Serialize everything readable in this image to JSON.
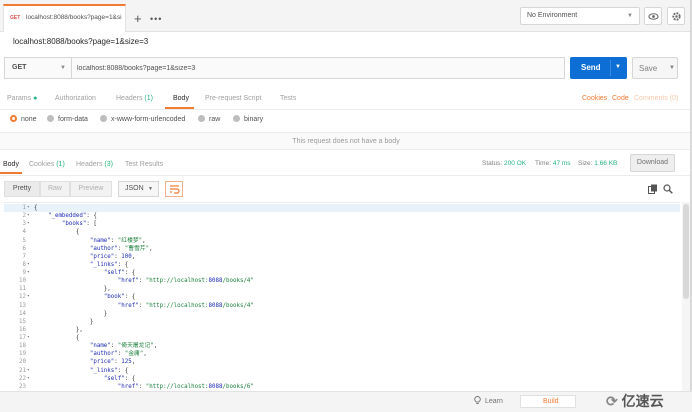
{
  "tab": {
    "method": "GET",
    "title": "localhost:8088/books?page=1&si"
  },
  "environment": {
    "selected": "No Environment"
  },
  "request": {
    "title": "localhost:8088/books?page=1&size=3",
    "method": "GET",
    "url": "localhost:8088/books?page=1&size=3",
    "send_label": "Send",
    "save_label": "Save"
  },
  "request_tabs": {
    "params": "Params",
    "authorization": "Authorization",
    "headers": "Headers",
    "headers_count": "(1)",
    "body": "Body",
    "prerequest": "Pre-request Script",
    "tests": "Tests",
    "cookies": "Cookies",
    "code": "Code",
    "comments": "Comments (0)"
  },
  "body_types": [
    "none",
    "form-data",
    "x-www-form-urlencoded",
    "raw",
    "binary"
  ],
  "no_body_message": "This request does not have a body",
  "response_tabs": {
    "body": "Body",
    "cookies": "Cookies",
    "cookies_count": "(1)",
    "headers": "Headers",
    "headers_count": "(3)",
    "test_results": "Test Results"
  },
  "response_status": {
    "status_label": "Status:",
    "status_value": "200 OK",
    "time_label": "Time:",
    "time_value": "47 ms",
    "size_label": "Size:",
    "size_value": "1.66 KB",
    "download_label": "Download"
  },
  "view_modes": [
    "Pretty",
    "Raw",
    "Preview"
  ],
  "format": "JSON",
  "code_lines": [
    "{",
    "    \"_embedded\": {",
    "        \"books\": [",
    "            {",
    "                \"name\": \"红楼梦\",",
    "                \"author\": \"曹雪芹\",",
    "                \"price\": 100,",
    "                \"_links\": {",
    "                    \"self\": {",
    "                        \"href\": \"http://localhost:8088/books/4\"",
    "                    },",
    "                    \"book\": {",
    "                        \"href\": \"http://localhost:8088/books/4\"",
    "                    }",
    "                }",
    "            },",
    "            {",
    "                \"name\": \"倚天屠龙记\",",
    "                \"author\": \"金庸\",",
    "                \"price\": 125,",
    "                \"_links\": {",
    "                    \"self\": {",
    "                        \"href\": \"http://localhost:8088/books/6\""
  ],
  "folded_lines": [
    1,
    2,
    3,
    8,
    9,
    12,
    17,
    21,
    22
  ],
  "status_bar": {
    "learn": "Learn",
    "build": "Build"
  },
  "watermark": "亿速云",
  "colors": {
    "accent": "#f27b33",
    "send": "#0d6fd6",
    "success": "#26b47f"
  }
}
